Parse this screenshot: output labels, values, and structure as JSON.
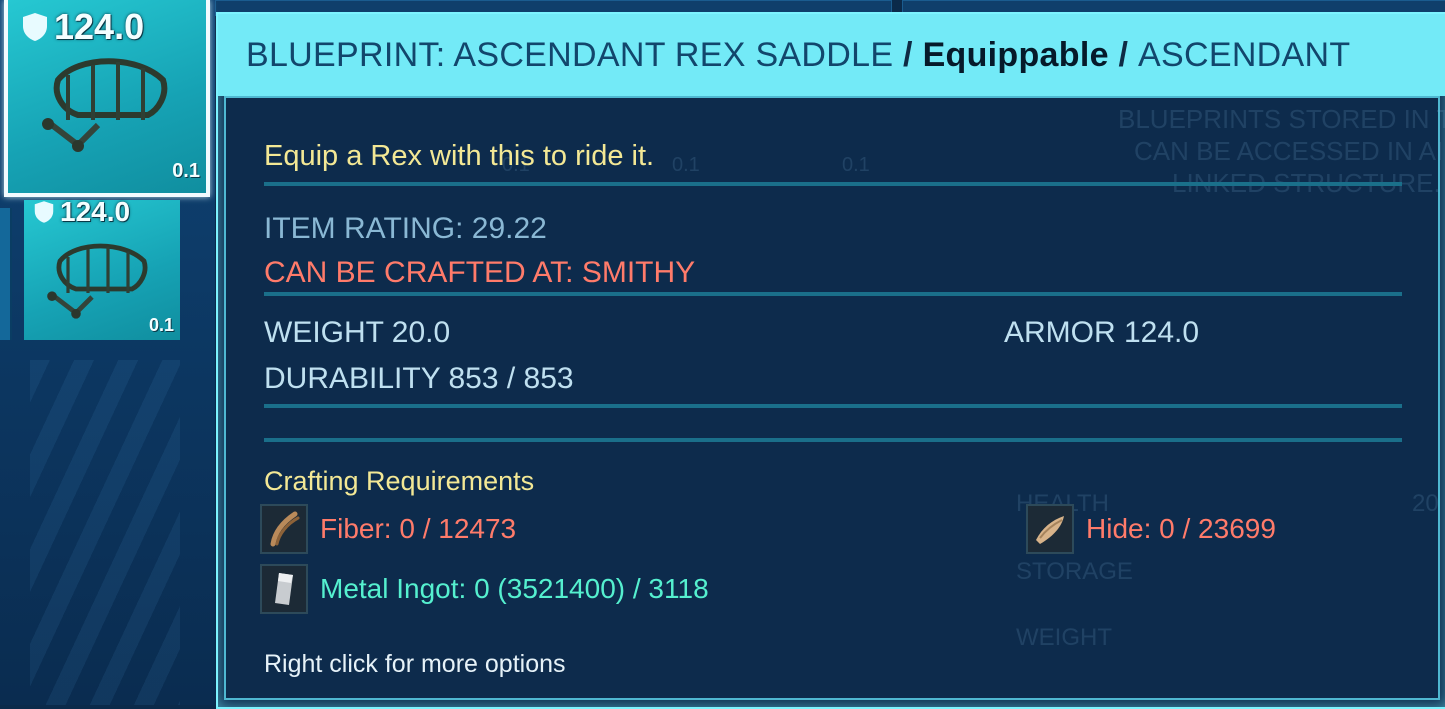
{
  "inventory": {
    "slots": [
      {
        "armor": "124.0",
        "weight": "0.1",
        "selected": true
      },
      {
        "armor": "124.0",
        "weight": "0.1",
        "selected": false
      }
    ]
  },
  "background": {
    "weights": [
      "0.1",
      "0.1",
      "0.1"
    ],
    "blueprint_note": [
      "BLUEPRINTS STORED IN T",
      "CAN BE ACCESSED IN AI",
      "LINKED STRUCTURE."
    ],
    "stats": [
      "HEALTH",
      "STORAGE",
      "WEIGHT"
    ],
    "health_value": "20"
  },
  "tooltip": {
    "title_name": "BLUEPRINT: ASCENDANT REX SADDLE",
    "separator": " / ",
    "title_type": "Equippable",
    "title_rarity": "ASCENDANT",
    "description": "Equip a Rex with this to ride it.",
    "item_rating": "ITEM RATING: 29.22",
    "crafted_at": "CAN BE CRAFTED AT: SMITHY",
    "weight": "WEIGHT 20.0",
    "armor": "ARMOR 124.0",
    "durability": "DURABILITY 853 / 853",
    "requirements_title": "Crafting Requirements",
    "requirements": [
      {
        "label": "Fiber: 0 / 12473",
        "icon": "fiber-icon",
        "status": "missing"
      },
      {
        "label": "Hide: 0 / 23699",
        "icon": "hide-icon",
        "status": "missing"
      },
      {
        "label": "Metal Ingot: 0 (3521400) / 3118",
        "icon": "metal-ingot-icon",
        "status": "ok"
      }
    ],
    "hint": "Right click for more options"
  },
  "colors": {
    "header_bg": "#73eaf7",
    "body_bg": "#0d2b4c",
    "description": "#f3e895",
    "missing": "#ff7b6a",
    "ok": "#55f0cf"
  }
}
